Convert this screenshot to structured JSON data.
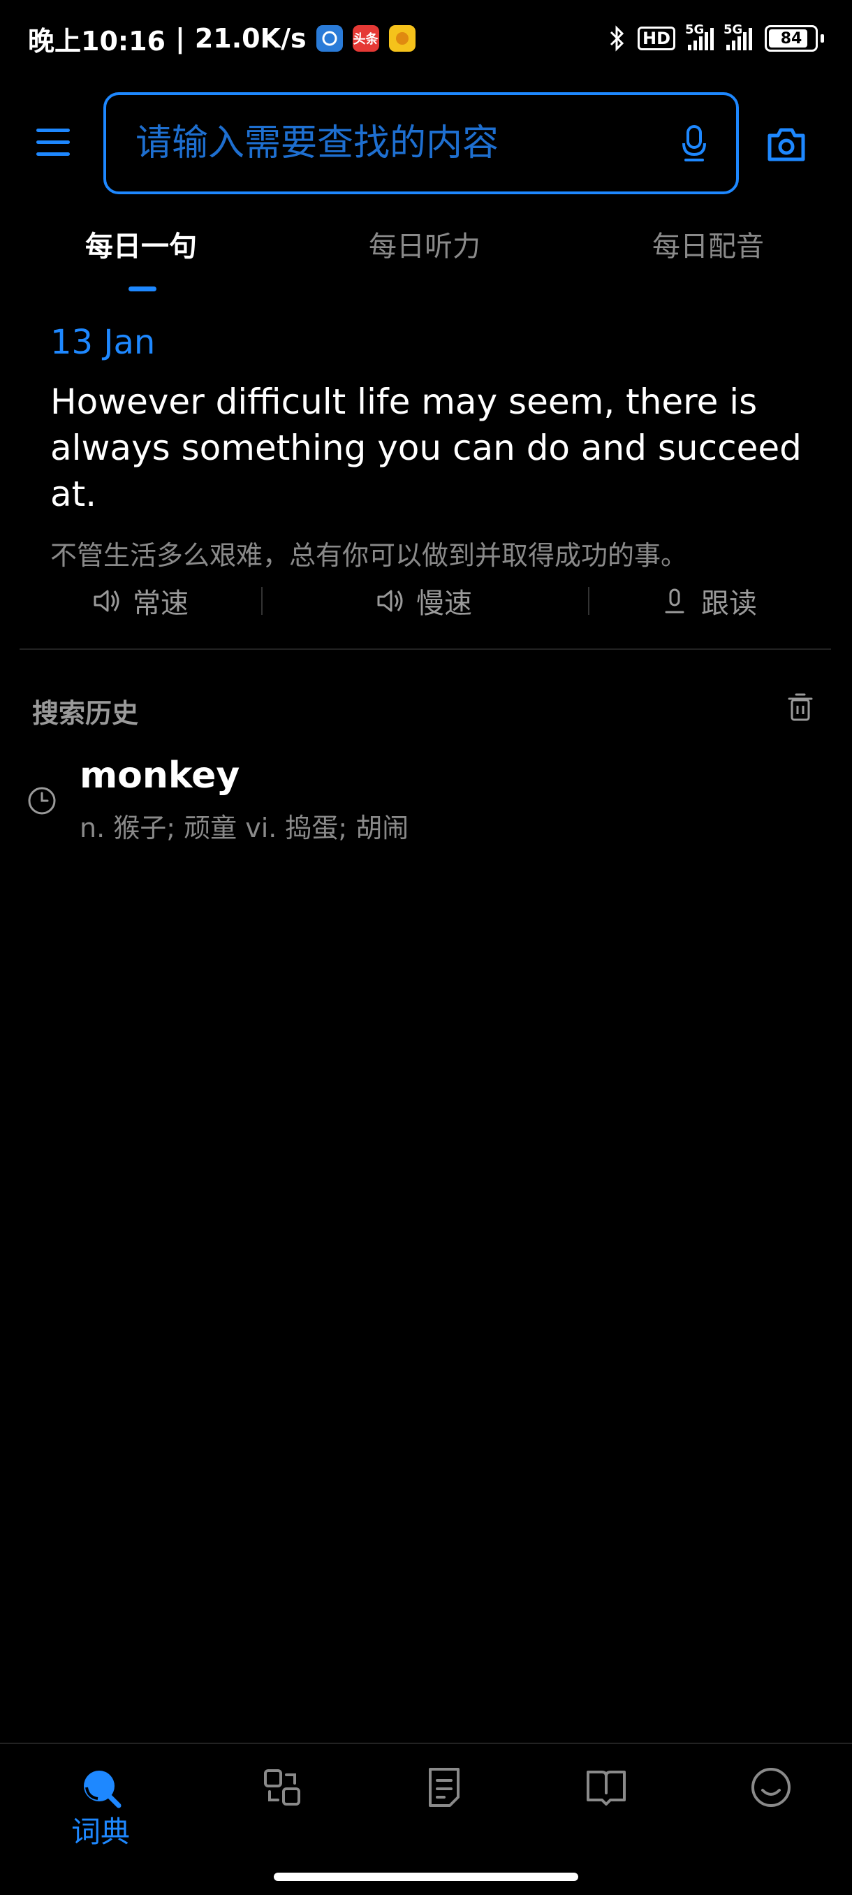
{
  "status_bar": {
    "time": "晚上10:16",
    "separator": "|",
    "net_speed": "21.0K/s",
    "app_badge_news": "头条",
    "hd_label": "HD",
    "signal1_tag": "5G",
    "signal2_tag": "5G",
    "battery": "84"
  },
  "search": {
    "placeholder": "请输入需要查找的内容"
  },
  "tabs": [
    "每日一句",
    "每日听力",
    "每日配音"
  ],
  "daily": {
    "date": "13 Jan",
    "sentence_en": "However difficult life may seem, there is always something you can do and succeed at.",
    "sentence_zh": "不管生活多么艰难，总有你可以做到并取得成功的事。"
  },
  "play": {
    "normal": "常速",
    "slow": "慢速",
    "follow": "跟读"
  },
  "history": {
    "title": "搜索历史",
    "items": [
      {
        "word": "monkey",
        "definition": "n. 猴子; 顽童 vi. 捣蛋; 胡闹"
      }
    ]
  },
  "nav": {
    "dictionary": "词典"
  },
  "colors": {
    "accent": "#1e88ff",
    "background": "#000000",
    "muted_text": "#8a8a8a"
  }
}
